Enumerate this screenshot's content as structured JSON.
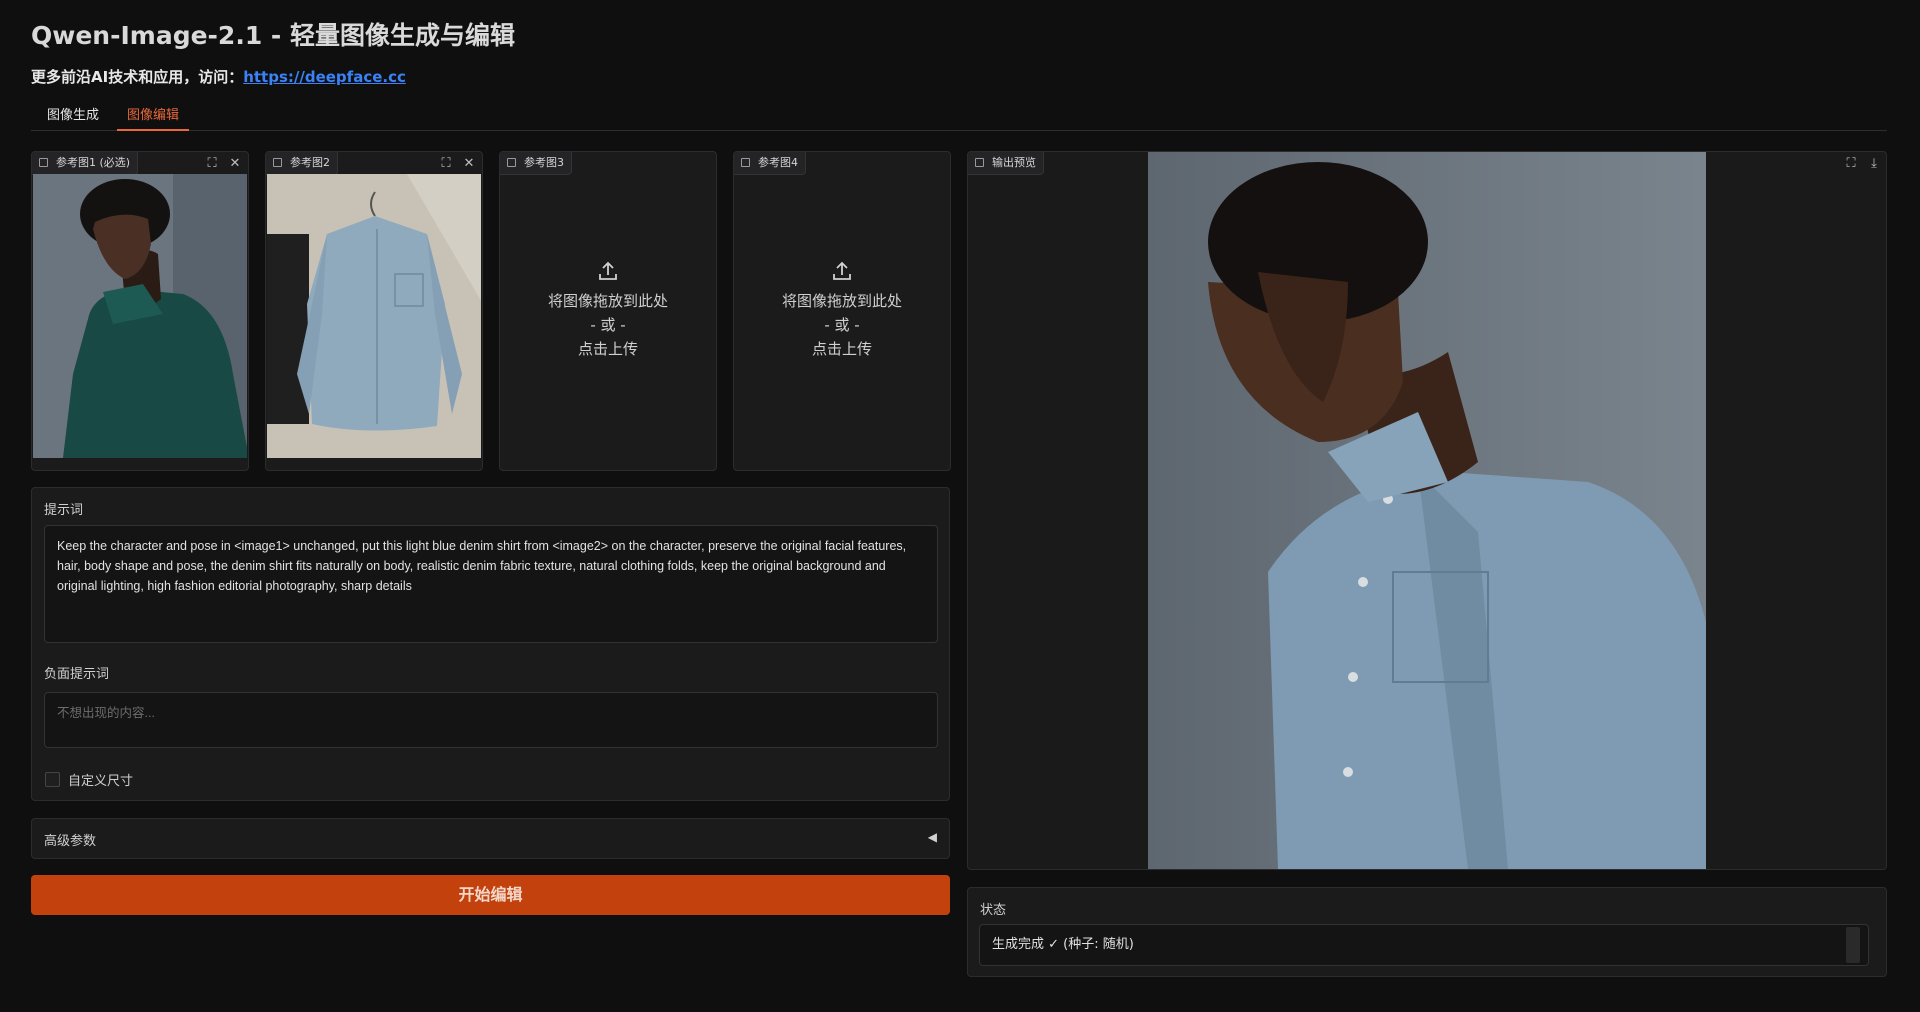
{
  "app": {
    "title": "Qwen-Image-2.1 - 轻量图像生成与编辑",
    "subtitle_prefix": "更多前沿AI技术和应用，访问：",
    "subtitle_link": "https://deepface.cc"
  },
  "tabs": [
    {
      "label": "图像生成",
      "active": false
    },
    {
      "label": "图像编辑",
      "active": true
    }
  ],
  "references": [
    {
      "label": "参考图1 (必选)",
      "filled": true
    },
    {
      "label": "参考图2",
      "filled": true
    },
    {
      "label": "参考图3",
      "filled": false
    },
    {
      "label": "参考图4",
      "filled": false
    }
  ],
  "upload": {
    "line1": "将图像拖放到此处",
    "line2": "- 或 -",
    "line3": "点击上传"
  },
  "prompt": {
    "label": "提示词",
    "value": "Keep the character and pose in <image1> unchanged, put this light blue denim shirt from <image2> on the character, preserve the original facial features, hair, body shape and pose, the denim shirt fits naturally on body, realistic denim fabric texture, natural clothing folds, keep the original background and original lighting, high fashion editorial photography, sharp details"
  },
  "negative_prompt": {
    "label": "负面提示词",
    "placeholder": "不想出现的内容..."
  },
  "custom_size": {
    "label": "自定义尺寸",
    "checked": false
  },
  "advanced": {
    "label": "高级参数"
  },
  "run_button": {
    "label": "开始编辑"
  },
  "output": {
    "label": "输出预览"
  },
  "status": {
    "label": "状态",
    "value": "生成完成 ✓ (种子: 随机)"
  },
  "colors": {
    "accent": "#e8683a",
    "button": "#c2410c",
    "link": "#3b82f6",
    "background": "#0f0f10"
  }
}
